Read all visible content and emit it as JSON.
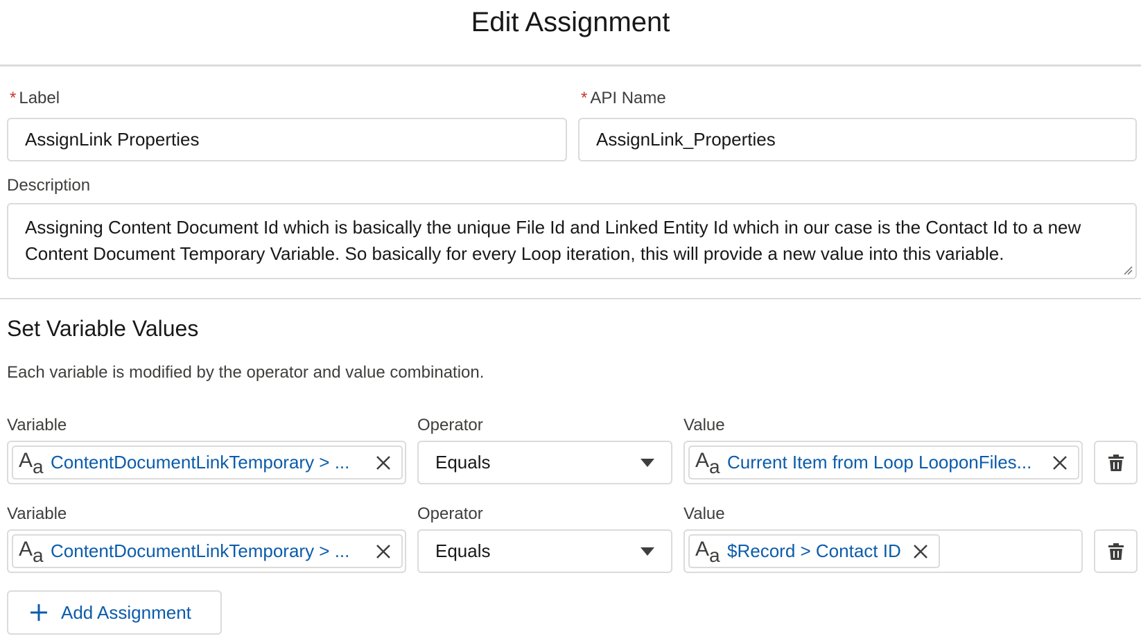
{
  "header": {
    "title": "Edit Assignment"
  },
  "form": {
    "label_field": {
      "label": "Label",
      "value": "AssignLink Properties"
    },
    "api_name_field": {
      "label": "API Name",
      "value": "AssignLink_Properties"
    },
    "required_mark": "*",
    "description": {
      "label": "Description",
      "value": "Assigning Content Document Id which is basically the unique File Id and Linked Entity Id which in our case is the Contact Id to a new Content Document Temporary Variable. So basically for every Loop iteration, this will provide a new value into this variable."
    }
  },
  "section": {
    "title": "Set Variable Values",
    "description": "Each variable is modified by the operator and value combination."
  },
  "assignments": [
    {
      "variable_label": "Variable",
      "variable_value": "ContentDocumentLinkTemporary > ...",
      "operator_label": "Operator",
      "operator_value": "Equals",
      "value_label": "Value",
      "value_value": "Current Item from Loop LooponFiles..."
    },
    {
      "variable_label": "Variable",
      "variable_value": "ContentDocumentLinkTemporary > ...",
      "operator_label": "Operator",
      "operator_value": "Equals",
      "value_label": "Value",
      "value_value": "$Record > Contact ID"
    }
  ],
  "resource_icon": {
    "upper": "A",
    "lower": "a",
    "name": "text-resource-icon"
  },
  "add_button": {
    "label": "Add Assignment"
  },
  "colors": {
    "link": "#0b5cab",
    "required": "#c23934",
    "border": "#dddbda"
  }
}
